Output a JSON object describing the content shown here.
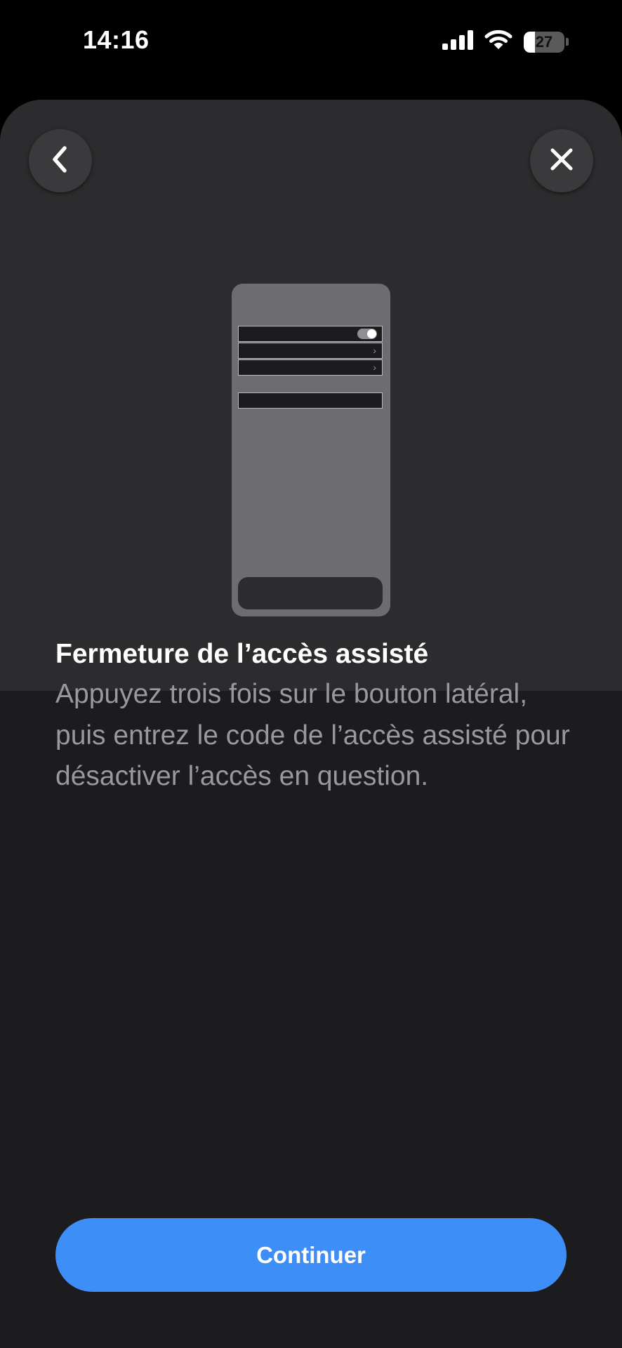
{
  "status_bar": {
    "time": "14:16",
    "battery_level": "27",
    "battery_fraction": 0.27,
    "icons": [
      "cellular-signal-icon",
      "wifi-icon",
      "battery-icon"
    ]
  },
  "sheet": {
    "back_icon": "chevron-left-icon",
    "close_icon": "close-icon",
    "illustration": {
      "rows": [
        "toggle-row",
        "chevron-row",
        "chevron-row",
        "plain-row"
      ],
      "chevron_glyph": "›"
    },
    "title": "Fermeture de l’accès assisté",
    "body": "Appuyez trois fois sur le bouton latéral, puis entrez le code de l’accès assisté pour désactiver l’accès en question.",
    "primary_button_label": "Continuer"
  },
  "colors": {
    "background": "#000000",
    "sheet_bottom": "#1c1c1e",
    "sheet_top": "#2c2c2e",
    "accent": "#3e8ef7",
    "title_text": "#ffffff",
    "body_text": "#98989f"
  }
}
